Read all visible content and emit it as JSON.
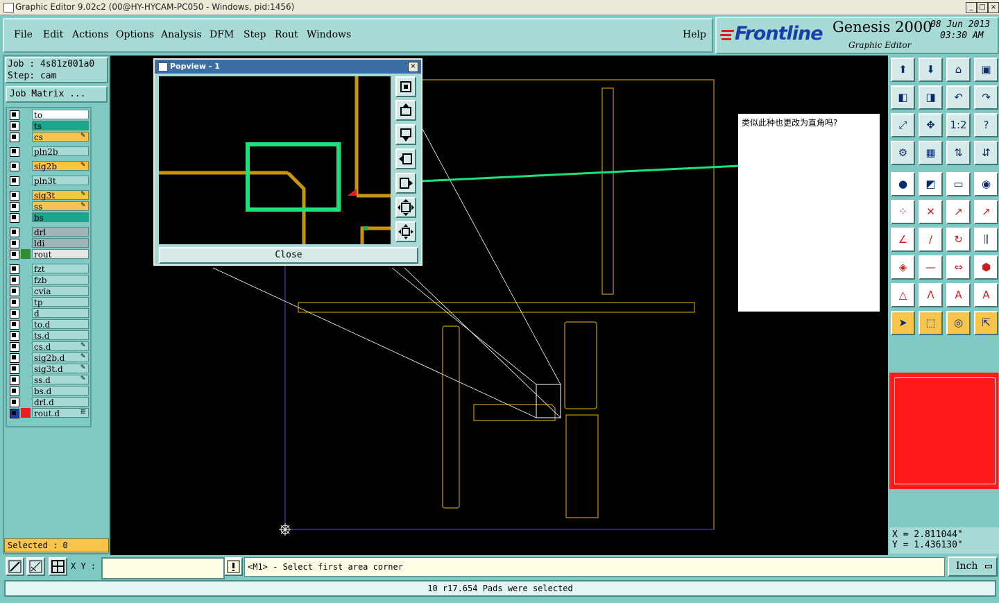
{
  "window": {
    "title": "Graphic Editor 9.02c2 (00@HY-HYCAM-PC050 - Windows, pid:1456)",
    "controls": [
      "_",
      "□",
      "×"
    ]
  },
  "menubar": {
    "items": [
      "File",
      "Edit",
      "Actions",
      "Options",
      "Analysis",
      "DFM",
      "Step",
      "Rout",
      "Windows"
    ],
    "help": "Help"
  },
  "branding": {
    "logo": "Frontline",
    "product": "Genesis 2000",
    "subtitle": "Graphic Editor",
    "date": "08 Jun 2013",
    "time": "03:30 AM"
  },
  "job": {
    "job_label": "Job : 4s81z001a0",
    "step_label": "Step: cam",
    "matrix_button": "Job Matrix ..."
  },
  "layers": [
    {
      "name": "to",
      "color": "#ffffff",
      "mark": ""
    },
    {
      "name": "ts",
      "color": "#1aa58c",
      "mark": ""
    },
    {
      "name": "cs",
      "color": "#f8c54a",
      "mark": "✎"
    },
    {
      "name": "pln2b",
      "color": "#a7d9d5",
      "mark": ""
    },
    {
      "name": "sig2b",
      "color": "#f8c54a",
      "mark": "✎"
    },
    {
      "name": "pln3t",
      "color": "#a7d9d5",
      "mark": ""
    },
    {
      "name": "sig3t",
      "color": "#f8c54a",
      "mark": "✎"
    },
    {
      "name": "ss",
      "color": "#f8c54a",
      "mark": "✎"
    },
    {
      "name": "bs",
      "color": "#1aa58c",
      "mark": ""
    },
    {
      "name": "drl",
      "color": "#9fb5b8",
      "mark": ""
    },
    {
      "name": "ldi",
      "color": "#9fb5b8",
      "mark": ""
    },
    {
      "name": "rout",
      "color": "#e6e6e6",
      "mark": ""
    },
    {
      "name": "fzt",
      "color": "#a7d9d5",
      "mark": ""
    },
    {
      "name": "fzb",
      "color": "#a7d9d5",
      "mark": ""
    },
    {
      "name": "cvia",
      "color": "#a7d9d5",
      "mark": ""
    },
    {
      "name": "tp",
      "color": "#a7d9d5",
      "mark": ""
    },
    {
      "name": "d",
      "color": "#a7d9d5",
      "mark": ""
    },
    {
      "name": "to.d",
      "color": "#a7d9d5",
      "mark": ""
    },
    {
      "name": "ts.d",
      "color": "#a7d9d5",
      "mark": ""
    },
    {
      "name": "cs.d",
      "color": "#a7d9d5",
      "mark": "✎"
    },
    {
      "name": "sig2b.d",
      "color": "#a7d9d5",
      "mark": "✎"
    },
    {
      "name": "sig3t.d",
      "color": "#a7d9d5",
      "mark": "✎"
    },
    {
      "name": "ss.d",
      "color": "#a7d9d5",
      "mark": "✎"
    },
    {
      "name": "bs.d",
      "color": "#a7d9d5",
      "mark": ""
    },
    {
      "name": "drl.d",
      "color": "#a7d9d5",
      "mark": ""
    },
    {
      "name": "rout.d",
      "color": "#a7d9d5",
      "mark": "⊞"
    }
  ],
  "selected": "Selected : 0",
  "popview": {
    "title": "Popview - 1",
    "close_button": "Close"
  },
  "annotation": {
    "text": "类似此种也更改为直角吗?"
  },
  "coordinates": {
    "x": "X = 2.811044\"",
    "y": "Y = 1.436130\""
  },
  "bottom": {
    "xy_label": "X Y :",
    "xy_value": "",
    "prompt": "<M1> - Select first area corner",
    "unit": "Inch"
  },
  "status": {
    "message": "10 r17.654 Pads were selected"
  },
  "colors": {
    "panel": "#7ec9c4",
    "panel_light": "#a7d9d5",
    "trace": "#c8960c",
    "highlight": "#19e37a",
    "accent_yellow": "#f8c54a"
  },
  "toolbar_icons": [
    "open-icon",
    "close-icon",
    "home-icon",
    "window-icon",
    "pan-left-icon",
    "pan-right-icon",
    "undo-icon",
    "redo-icon",
    "fit-icon",
    "zoom-icon",
    "scale-icon",
    "help-icon",
    "measure-icon",
    "grid-icon",
    "layers-icon",
    "layers-alt-icon",
    "feature-icon",
    "snap-icon",
    "ruler-icon",
    "pad-icon",
    "node-icon",
    "cross-icon",
    "line-icon",
    "arc-icon",
    "draw-icon",
    "slash-icon",
    "rotate-icon",
    "mirror-icon",
    "pad-add-icon",
    "cut-icon",
    "stretch-icon",
    "shape-icon",
    "triangle-icon",
    "text-a-icon",
    "text-box-icon",
    "text-line-icon",
    "pointer-icon",
    "select-icon",
    "select-alt-icon",
    "select-multi-icon"
  ]
}
